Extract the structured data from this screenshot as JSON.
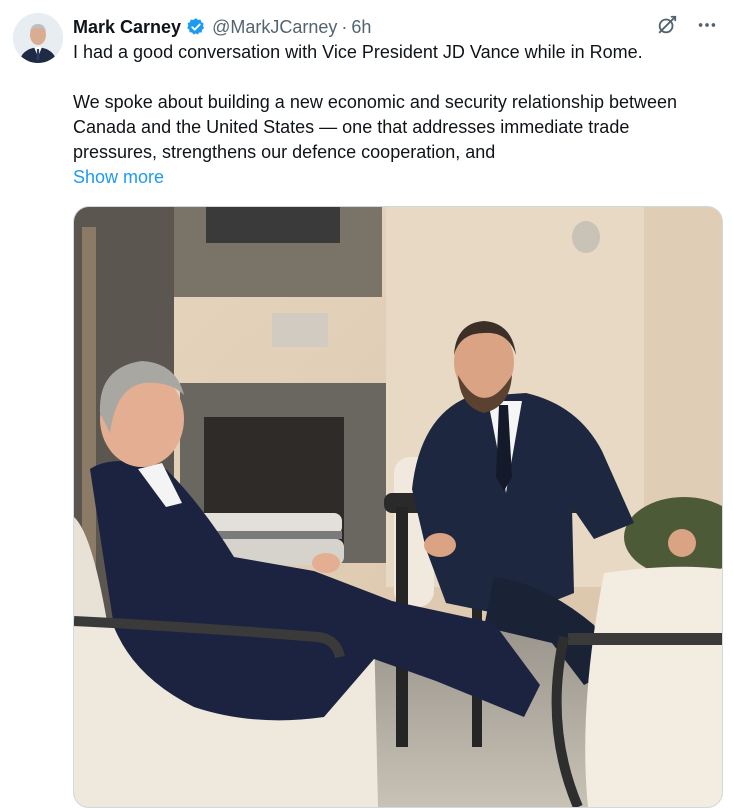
{
  "author": {
    "display_name": "Mark Carney",
    "handle": "@MarkJCarney",
    "separator": "·",
    "timestamp": "6h",
    "verified": true
  },
  "tweet": {
    "paragraph_1": "I had a good conversation with Vice President JD Vance while in Rome.",
    "paragraph_2": "We spoke about building a new economic and security relationship between Canada and the United States — one that addresses immediate trade pressures, strengthens our defence cooperation, and",
    "show_more": "Show more"
  },
  "icons": {
    "verified": "verified-badge-icon",
    "grok": "grok-icon",
    "more": "more-dots-icon"
  },
  "colors": {
    "link": "#1d9bf0",
    "verified": "#1d9bf0",
    "secondary_text": "#536471"
  }
}
